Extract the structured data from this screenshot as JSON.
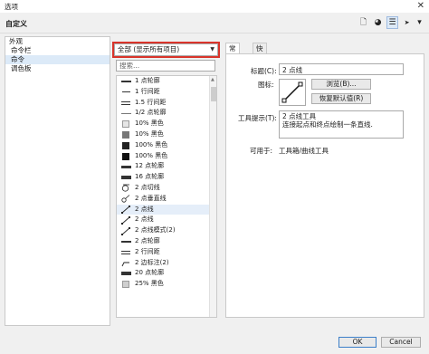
{
  "window": {
    "title": "选项",
    "close_glyph": "✕"
  },
  "header": {
    "section_title": "自定义"
  },
  "toolbar_icons": [
    {
      "name": "new-document-icon",
      "glyph": "🗋"
    },
    {
      "name": "color-wheel-icon",
      "glyph": "◕"
    },
    {
      "name": "command-list-icon",
      "glyph": "☰"
    },
    {
      "name": "pointer-icon",
      "glyph": "➤"
    },
    {
      "name": "dropdown-arrow-icon",
      "glyph": "▾"
    }
  ],
  "tree": {
    "items": [
      {
        "label": "外观",
        "level": 0
      },
      {
        "label": "命令栏",
        "level": 1
      },
      {
        "label": "命令",
        "level": 1,
        "selected": true
      },
      {
        "label": "调色板",
        "level": 1
      }
    ]
  },
  "filter": {
    "value": "全部 (显示所有项目)",
    "arrow": "▼"
  },
  "search": {
    "placeholder": "搜索..."
  },
  "commands": [
    {
      "label": "1 点轮廓",
      "icon": "line-1pt"
    },
    {
      "label": "1 行间距",
      "icon": "line-thin"
    },
    {
      "label": "1.5 行间距",
      "icon": "line-double"
    },
    {
      "label": "1/2 点轮廓",
      "icon": "line-hair"
    },
    {
      "label": "10% 黑色",
      "icon": "sq-10"
    },
    {
      "label": "10% 黑色",
      "icon": "sq-10b"
    },
    {
      "label": "100% 黑色",
      "icon": "sq-100"
    },
    {
      "label": "100% 黑色",
      "icon": "sq-100b"
    },
    {
      "label": "12 点轮廓",
      "icon": "line-12"
    },
    {
      "label": "16 点轮廓",
      "icon": "line-16"
    },
    {
      "label": "2 点切线",
      "icon": "tangent"
    },
    {
      "label": "2 点垂直线",
      "icon": "perpendicular"
    },
    {
      "label": "2 点线",
      "icon": "two-point",
      "selected": true
    },
    {
      "label": "2 点线",
      "icon": "two-point"
    },
    {
      "label": "2 点线模式(2)",
      "icon": "two-point"
    },
    {
      "label": "2 点轮廓",
      "icon": "line-2pt"
    },
    {
      "label": "2 行间距",
      "icon": "line-double"
    },
    {
      "label": "2 边标注(2)",
      "icon": "callout"
    },
    {
      "label": "20 点轮廓",
      "icon": "line-20"
    },
    {
      "label": "25% 黑色",
      "icon": "sq-25"
    }
  ],
  "tabs": [
    {
      "label": "常规",
      "active": true
    },
    {
      "label": "快捷键",
      "active": false
    }
  ],
  "general": {
    "caption_label": "标题(C):",
    "caption_value": "2 点线",
    "icon_label": "图标:",
    "browse_button": "浏览(B)...",
    "reset_button": "恢复默认值(R)",
    "tooltip_label": "工具提示(T):",
    "tooltip_line1": "2 点线工具",
    "tooltip_line2": "连接起点和终点绘制一条直线.",
    "available_label": "可用于:",
    "available_value": "工具箱/曲线工具"
  },
  "footer": {
    "ok_button": "OK",
    "cancel_button": "Cancel"
  }
}
